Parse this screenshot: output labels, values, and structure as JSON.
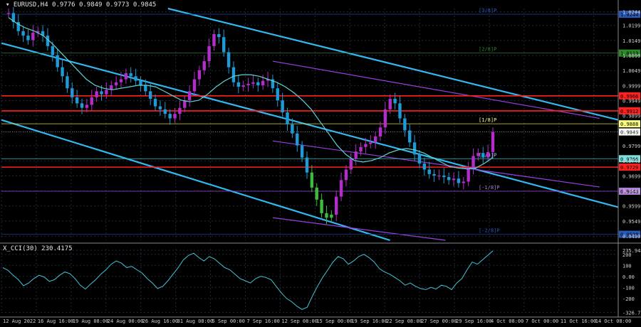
{
  "header": {
    "symbol_line": "EURUSD,H4  0.9776 0.9849 0.9773 0.9845",
    "indicator_line": "X_CCI(30) 230.4175"
  },
  "colors": {
    "background": "#000000",
    "grid": "#1f2a38",
    "bull": "#b22dc9",
    "bear": "#1f9ad6",
    "highlight": "#3dbb3d",
    "ma": "#5fd3d3",
    "channel": "#33b7ee",
    "channel_inner": "#9a3fe0",
    "level_red": "#ff2020",
    "cci": "#45c3d6"
  },
  "chart_data": [
    {
      "type": "line",
      "subtype": "candlestick",
      "symbol": "EURUSD",
      "timeframe": "H4",
      "ohlc_current": {
        "open": 0.9776,
        "high": 0.9849,
        "low": 0.9773,
        "close": 0.9845
      },
      "ylim": [
        0.9485,
        1.0255
      ],
      "y_ticks": [
        "1.0244",
        "1.0199",
        "1.0149",
        "1.0099",
        "1.0049",
        "0.9999",
        "0.9949",
        "0.9899",
        "0.9845",
        "0.9799",
        "0.9749",
        "0.9699",
        "0.9649",
        "0.9599",
        "0.9549",
        "0.9499"
      ],
      "x_ticks": [
        "12 Aug 2022",
        "16 Aug 16:00",
        "19 Aug 08:00",
        "24 Aug 00:00",
        "26 Aug 16:00",
        "31 Aug 08:00",
        "5 Sep 00:00",
        "7 Sep 16:00",
        "12 Sep 08:00",
        "15 Sep 00:00",
        "19 Sep 16:00",
        "22 Sep 08:00",
        "27 Sep 00:00",
        "29 Sep 16:00",
        "4 Oct 08:00",
        "7 Oct 00:00",
        "11 Oct 16:00",
        "14 Oct 08:00"
      ],
      "close_path": [
        1.024,
        1.021,
        1.018,
        1.0165,
        1.015,
        1.0175,
        1.018,
        1.0165,
        1.013,
        1.01,
        1.006,
        1.003,
        0.999,
        0.996,
        0.994,
        0.9925,
        0.9935,
        0.996,
        0.998,
        0.997,
        0.9985,
        1.0,
        1.001,
        1.002,
        1.004,
        1.003,
        1.0015,
        1.0,
        0.998,
        0.9955,
        0.993,
        0.992,
        0.9905,
        0.989,
        0.9905,
        0.9925,
        0.995,
        0.998,
        1.002,
        1.005,
        1.008,
        1.013,
        1.017,
        1.016,
        1.011,
        1.006,
        1.001,
        0.9995,
        1.0,
        1.0005,
        1.001,
        1.0,
        1.0015,
        1.002,
        0.999,
        0.995,
        0.991,
        0.987,
        0.984,
        0.98,
        0.976,
        0.971,
        0.966,
        0.962,
        0.9575,
        0.956,
        0.957,
        0.963,
        0.9685,
        0.972,
        0.9755,
        0.978,
        0.9795,
        0.9805,
        0.981,
        0.983,
        0.986,
        0.992,
        0.9955,
        0.994,
        0.989,
        0.985,
        0.981,
        0.977,
        0.974,
        0.972,
        0.9705,
        0.97,
        0.97,
        0.9695,
        0.9685,
        0.969,
        0.9675,
        0.968,
        0.9725,
        0.9765,
        0.9775,
        0.976,
        0.9778,
        0.9845
      ],
      "moving_average": [
        1.0225,
        1.0205,
        1.019,
        1.018,
        1.0165,
        1.014,
        1.011,
        1.008,
        1.005,
        1.002,
        1.0,
        0.999,
        0.9985,
        0.999,
        0.9995,
        1.0,
        1.0,
        0.9995,
        0.998,
        0.9965,
        0.995,
        0.9945,
        0.995,
        0.997,
        0.9995,
        1.0015,
        1.003,
        1.0035,
        1.0035,
        1.003,
        1.002,
        1.001,
        0.9995,
        0.9975,
        0.995,
        0.992,
        0.988,
        0.984,
        0.98,
        0.977,
        0.975,
        0.9745,
        0.975,
        0.976,
        0.9775,
        0.9785,
        0.979,
        0.9785,
        0.9775,
        0.976,
        0.9745,
        0.973,
        0.9725,
        0.9722,
        0.9725,
        0.974,
        0.976
      ],
      "channels": [
        {
          "name": "upper",
          "p1": [
            0.27,
            1.0255
          ],
          "p2": [
            1.0,
            0.9885
          ]
        },
        {
          "name": "middle",
          "p1": [
            0.0,
            1.014
          ],
          "p2": [
            1.0,
            0.9595
          ]
        },
        {
          "name": "lower",
          "p1": [
            0.0,
            0.9885
          ],
          "p2": [
            0.63,
            0.9485
          ]
        },
        {
          "name": "inner-top",
          "p1": [
            0.44,
            1.008
          ],
          "p2": [
            0.97,
            0.989
          ]
        },
        {
          "name": "inner-mid",
          "p1": [
            0.44,
            0.9815
          ],
          "p2": [
            0.97,
            0.9662
          ]
        },
        {
          "name": "inner-low",
          "p1": [
            0.44,
            0.956
          ],
          "p2": [
            0.72,
            0.9485
          ]
        }
      ],
      "levels": [
        {
          "value": 0.9965,
          "color": "#ff2020",
          "label": "0.9966",
          "label_bg": "#ff2020",
          "tag": ""
        },
        {
          "value": 0.9915,
          "color": "#ff2020",
          "label": "0.9912",
          "label_bg": "#ff2020",
          "tag": ""
        },
        {
          "value": 0.9728,
          "color": "#ff2020",
          "label": "0.9729",
          "label_bg": "#ff2020",
          "tag": ""
        },
        {
          "value": 0.9872,
          "color": "#d9d940",
          "label": "0.9888",
          "label_bg": "#ffff80",
          "tag": "[1/8]P"
        },
        {
          "value": 0.9756,
          "color": "#3fc0c0",
          "label": "0.9766",
          "label_bg": "#7fe0e0",
          "tag": "[0/8]P"
        },
        {
          "value": 0.9648,
          "color": "#9a3fe0",
          "label": "0.9648",
          "label_bg": "#b07fd9",
          "tag": "[-1/8]P"
        },
        {
          "value": 1.0107,
          "color": "#2c6e2c",
          "label": "1.0113",
          "label_bg": "#2c8a2c",
          "tag": "[2/8]P"
        },
        {
          "value": 1.0236,
          "color": "#1a3a8a",
          "label": "1.0244",
          "label_bg": "#2a5ab8",
          "tag": "[3/8]P"
        },
        {
          "value": 0.9505,
          "color": "#1a3a8a",
          "label": "0.9528",
          "label_bg": "#2a5ab8",
          "tag": "[-2/8]P"
        }
      ]
    },
    {
      "type": "line",
      "name": "X_CCI(30)",
      "current_value": 230.4175,
      "ylim": [
        -330,
        250
      ],
      "y_ticks": [
        "235.9485",
        "200",
        "100",
        "0.00",
        "-100",
        "-200",
        "-326.7732"
      ],
      "values": [
        80,
        55,
        10,
        -30,
        -85,
        -60,
        -20,
        10,
        -5,
        -45,
        -30,
        10,
        40,
        25,
        -20,
        -80,
        -115,
        -70,
        -30,
        20,
        60,
        110,
        140,
        120,
        80,
        90,
        60,
        30,
        -20,
        -60,
        -110,
        -90,
        -40,
        20,
        80,
        150,
        190,
        210,
        170,
        140,
        180,
        160,
        120,
        80,
        60,
        20,
        -20,
        -40,
        -60,
        -20,
        0,
        -10,
        -30,
        -90,
        -150,
        -200,
        -230,
        -270,
        -300,
        -280,
        -180,
        -90,
        -10,
        60,
        130,
        180,
        160,
        110,
        140,
        180,
        200,
        170,
        130,
        70,
        40,
        20,
        -10,
        -40,
        -80,
        -60,
        -90,
        -110,
        -120,
        -100,
        -115,
        -80,
        -90,
        -120,
        -60,
        -20,
        60,
        130,
        110,
        150,
        190,
        231
      ]
    }
  ]
}
